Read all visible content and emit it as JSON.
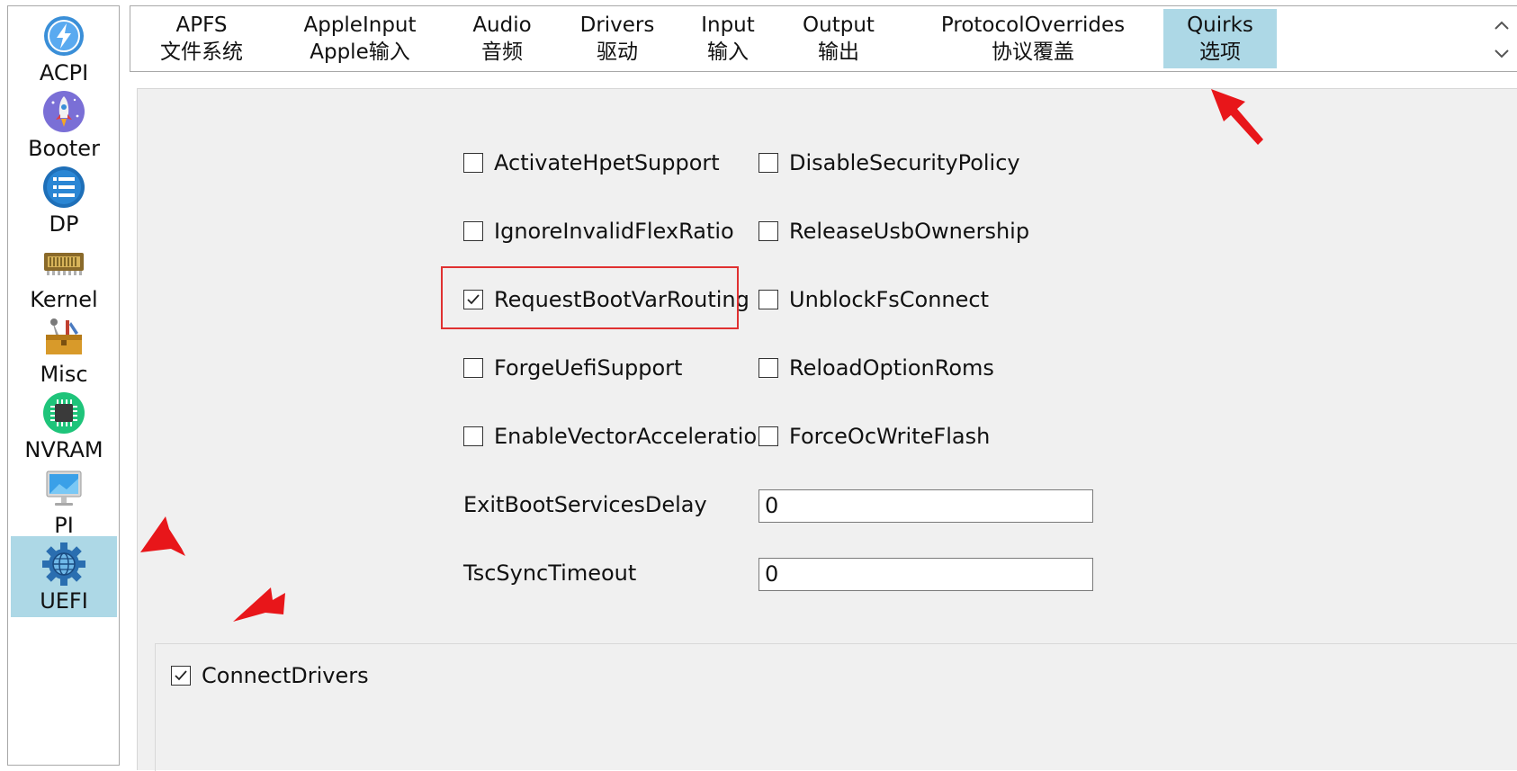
{
  "sidebar": {
    "items": [
      {
        "label": "ACPI",
        "icon": "acpi-lightning-icon"
      },
      {
        "label": "Booter",
        "icon": "booter-rocket-icon"
      },
      {
        "label": "DP",
        "icon": "dp-list-icon"
      },
      {
        "label": "Kernel",
        "icon": "kernel-chip-icon"
      },
      {
        "label": "Misc",
        "icon": "misc-toolbox-icon"
      },
      {
        "label": "NVRAM",
        "icon": "nvram-chip-icon"
      },
      {
        "label": "PI",
        "icon": "pi-monitor-icon"
      },
      {
        "label": "UEFI",
        "icon": "uefi-gear-icon",
        "selected": true
      }
    ]
  },
  "tabs": [
    {
      "line1": "APFS",
      "line2": "文件系统"
    },
    {
      "line1": "AppleInput",
      "line2": "Apple输入"
    },
    {
      "line1": "Audio",
      "line2": "音频"
    },
    {
      "line1": "Drivers",
      "line2": "驱动"
    },
    {
      "line1": "Input",
      "line2": "输入"
    },
    {
      "line1": "Output",
      "line2": "输出"
    },
    {
      "line1": "ProtocolOverrides",
      "line2": "协议覆盖"
    },
    {
      "line1": "Quirks",
      "line2": "选项",
      "selected": true
    }
  ],
  "quirks": {
    "left": [
      {
        "label": "ActivateHpetSupport",
        "checked": false
      },
      {
        "label": "IgnoreInvalidFlexRatio",
        "checked": false
      },
      {
        "label": "RequestBootVarRouting",
        "checked": true
      },
      {
        "label": "ForgeUefiSupport",
        "checked": false
      },
      {
        "label": "EnableVectorAcceleration",
        "checked": false
      }
    ],
    "right": [
      {
        "label": "DisableSecurityPolicy",
        "checked": false
      },
      {
        "label": "ReleaseUsbOwnership",
        "checked": false
      },
      {
        "label": "UnblockFsConnect",
        "checked": false
      },
      {
        "label": "ReloadOptionRoms",
        "checked": false
      },
      {
        "label": "ForceOcWriteFlash",
        "checked": false
      }
    ],
    "exit_boot_services_delay_label": "ExitBootServicesDelay",
    "exit_boot_services_delay_value": "0",
    "tsc_sync_timeout_label": "TscSyncTimeout",
    "tsc_sync_timeout_value": "0"
  },
  "connect_drivers": {
    "label": "ConnectDrivers",
    "checked": true
  },
  "colors": {
    "selected_bg": "#add8e6",
    "annotation_red": "#e8161a",
    "panel_bg": "#f0f0f0"
  }
}
